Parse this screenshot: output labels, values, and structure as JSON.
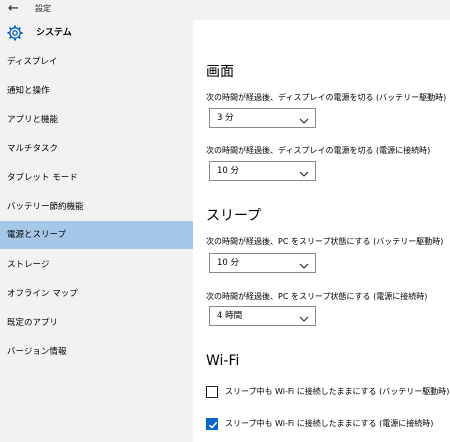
{
  "titlebar": {
    "back_glyph": "←",
    "title": "設定"
  },
  "header": {
    "icon": "gear-icon",
    "title": "システム"
  },
  "sidebar": {
    "items": [
      {
        "label": "ディスプレイ",
        "active": false
      },
      {
        "label": "通知と操作",
        "active": false
      },
      {
        "label": "アプリと機能",
        "active": false
      },
      {
        "label": "マルチタスク",
        "active": false
      },
      {
        "label": "タブレット モード",
        "active": false
      },
      {
        "label": "バッテリー節約機能",
        "active": false
      },
      {
        "label": "電源とスリープ",
        "active": true
      },
      {
        "label": "ストレージ",
        "active": false
      },
      {
        "label": "オフライン マップ",
        "active": false
      },
      {
        "label": "既定のアプリ",
        "active": false
      },
      {
        "label": "バージョン情報",
        "active": false
      }
    ]
  },
  "main": {
    "screen": {
      "title": "画面",
      "battery_label": "次の時間が経過後、ディスプレイの電源を切る (バッテリー駆動時)",
      "battery_value": "3 分",
      "plugged_label": "次の時間が経過後、ディスプレイの電源を切る (電源に接続時)",
      "plugged_value": "10 分"
    },
    "sleep": {
      "title": "スリープ",
      "battery_label": "次の時間が経過後、PC をスリープ状態にする (バッテリー駆動時)",
      "battery_value": "10 分",
      "plugged_label": "次の時間が経過後、PC をスリープ状態にする (電源に接続時)",
      "plugged_value": "4 時間"
    },
    "wifi": {
      "title": "Wi-Fi",
      "battery_label": "スリープ中も Wi-Fi に接続したままにする (バッテリー駆動時)",
      "battery_checked": false,
      "plugged_label": "スリープ中も Wi-Fi に接続したままにする (電源に接続時)",
      "plugged_checked": true
    }
  },
  "colors": {
    "accent": "#0a66c8",
    "sidebar_bg": "#f2f2f2",
    "active_item": "#a6c8e8"
  }
}
